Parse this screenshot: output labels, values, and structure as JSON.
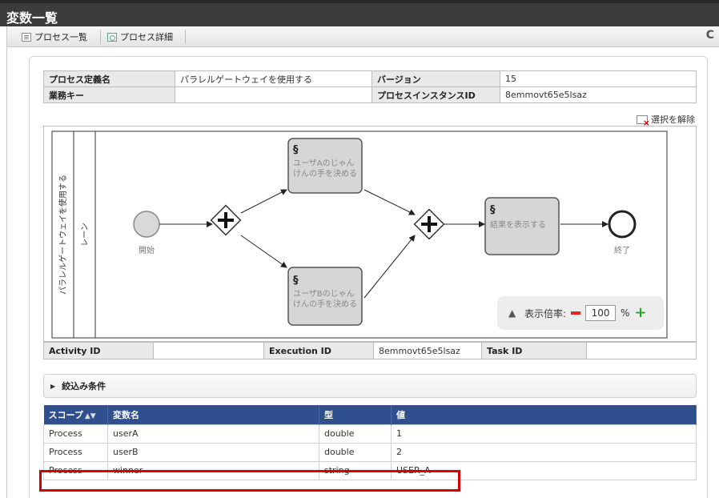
{
  "header": {
    "title": "変数一覧"
  },
  "toolbar": {
    "process_list_label": "プロセス一覧",
    "process_detail_label": "プロセス詳細",
    "refresh_icon": "refresh-icon"
  },
  "info": {
    "process_def_name_label": "プロセス定義名",
    "process_def_name": "パラレルゲートウェイを使用する",
    "version_label": "バージョン",
    "version": "15",
    "business_key_label": "業務キー",
    "business_key": "",
    "instance_id_label": "プロセスインスタンスID",
    "instance_id": "8emmovt65e5lsaz"
  },
  "clear_selection_label": "選択を解除",
  "diagram": {
    "pool_label": "パラレルゲートウェイを使用する",
    "lane_label": "レーン",
    "start_label": "開始",
    "end_label": "終了",
    "task_a_line1": "ユーザAのじゃん",
    "task_a_line2": "けんの手を決める",
    "task_b_line1": "ユーザBのじゃん",
    "task_b_line2": "けんの手を決める",
    "task_result": "結果を表示する",
    "zoom_label": "表示倍率:",
    "zoom_value": "100",
    "zoom_unit": "%"
  },
  "ids": {
    "activity_id_label": "Activity ID",
    "activity_id": "",
    "execution_id_label": "Execution ID",
    "execution_id": "8emmovt65e5lsaz",
    "task_id_label": "Task ID",
    "task_id": ""
  },
  "filter": {
    "label": "絞込み条件"
  },
  "variables": {
    "columns": [
      "スコープ",
      "変数名",
      "型",
      "値"
    ],
    "rows": [
      [
        "Process",
        "userA",
        "double",
        "1"
      ],
      [
        "Process",
        "userB",
        "double",
        "2"
      ],
      [
        "Process",
        "winner",
        "string",
        "USER_A"
      ]
    ]
  },
  "colors": {
    "accent": "#2f4f8f",
    "highlight": "#d40000",
    "titlebar": "#3c3c3c"
  }
}
